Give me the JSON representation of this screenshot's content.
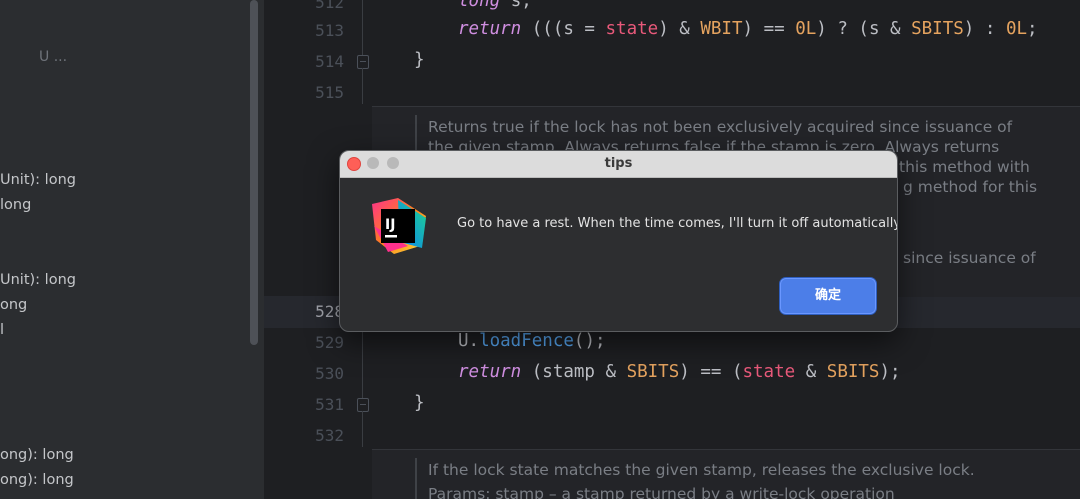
{
  "structure_panel": {
    "u_label": "U ...",
    "items": [
      "Unit): long",
      "long",
      "Unit): long",
      "ong",
      "l",
      "ong): long",
      "ong): long"
    ]
  },
  "editor": {
    "gutter": [
      "512",
      "513",
      "514",
      "515",
      "528",
      "529",
      "530",
      "531",
      "532"
    ],
    "code": {
      "line512_kw": "long",
      "line512_rest": " s;",
      "line513_kw": "return",
      "line513_a": " (((s = ",
      "line513_state": "state",
      "line513_b": ") & ",
      "line513_wbit": "WBIT",
      "line513_c": ") == ",
      "line513_zero1": "0L",
      "line513_d": ") ? (s & ",
      "line513_sbits": "SBITS",
      "line513_e": ") : ",
      "line513_zero2": "0L",
      "line513_f": ";",
      "line514": "}",
      "line529_obj": "U.",
      "line529_method": "loadFence",
      "line529_rest": "();",
      "line530_kw": "return",
      "line530_a": " (stamp & ",
      "line530_sbits1": "SBITS",
      "line530_b": ") == (",
      "line530_state": "state",
      "line530_c": " & ",
      "line530_sbits2": "SBITS",
      "line530_d": ");",
      "line531": "}"
    },
    "doc1": [
      "Returns true if the lock has not been exclusively acquired since issuance of",
      "the given stamp. Always returns false if the stamp is zero. Always returns",
      "this method with",
      "g method for this",
      "since issuance of"
    ],
    "doc2": [
      "If the lock state matches the given stamp, releases the exclusive lock.",
      "Params: stamp – a stamp returned by a write-lock operation"
    ]
  },
  "dialog": {
    "title": "tips",
    "message": "Go to have a rest. When the time comes, I'll turn it off automatically.",
    "ok_label": "确定",
    "logo_text": "IJ",
    "icon": "intellij-logo-icon"
  }
}
